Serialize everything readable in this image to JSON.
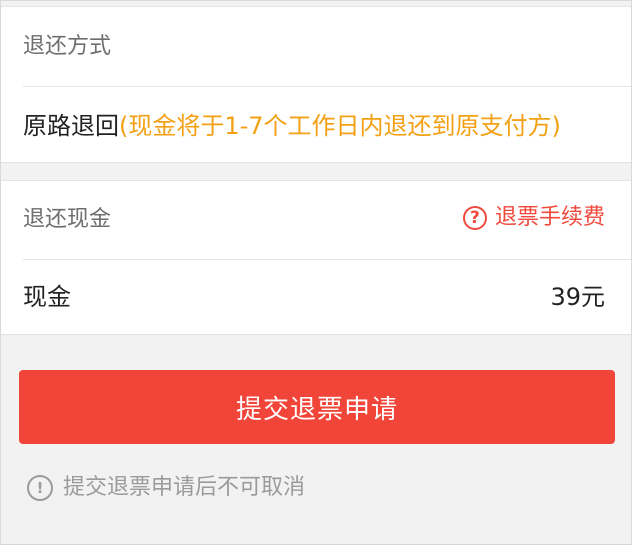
{
  "refund_method": {
    "title": "退还方式",
    "method_label": "原路退回",
    "method_note": "(现金将于1-7个工作日内退还到原支付方)"
  },
  "refund_cash": {
    "title": "退还现金",
    "fee_link_label": "退票手续费",
    "cash_label": "现金",
    "cash_amount": "39元"
  },
  "actions": {
    "submit_label": "提交退票申请"
  },
  "notice": {
    "text": "提交退票申请后不可取消"
  },
  "icons": {
    "fee_help": "question-circle-icon",
    "notice": "exclamation-circle-icon"
  },
  "colors": {
    "accent_red": "#f24539",
    "note_orange": "#f3a014",
    "text_gray": "#9b9b9b"
  }
}
